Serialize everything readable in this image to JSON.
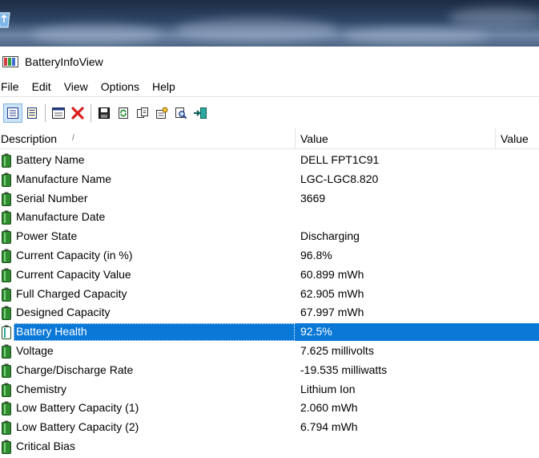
{
  "window": {
    "title": "BatteryInfoView",
    "title_icon": "battery-app-icon"
  },
  "menu": [
    "File",
    "Edit",
    "View",
    "Options",
    "Help"
  ],
  "toolbar": {
    "buttons": [
      {
        "icon": "details-view-icon"
      },
      {
        "icon": "report-view-icon"
      },
      {
        "icon": "properties-window-icon"
      },
      {
        "icon": "delete-red-x-icon"
      },
      {
        "icon": "save-icon"
      },
      {
        "icon": "refresh-icon"
      },
      {
        "icon": "copy-icon"
      },
      {
        "icon": "options-icon"
      },
      {
        "icon": "find-icon"
      },
      {
        "icon": "exit-icon"
      }
    ]
  },
  "table": {
    "columns": [
      "Description",
      "Value",
      "Value"
    ],
    "sort_indicator": "/",
    "rows": [
      {
        "description": "Battery Name",
        "value": "DELL FPT1C91"
      },
      {
        "description": "Manufacture Name",
        "value": "LGC-LGC8.820"
      },
      {
        "description": "Serial Number",
        "value": "3669"
      },
      {
        "description": "Manufacture Date",
        "value": ""
      },
      {
        "description": "Power State",
        "value": "Discharging"
      },
      {
        "description": "Current Capacity (in %)",
        "value": "96.8%"
      },
      {
        "description": "Current Capacity Value",
        "value": "60.899 mWh"
      },
      {
        "description": "Full Charged Capacity",
        "value": "62.905 mWh"
      },
      {
        "description": "Designed Capacity",
        "value": "67.997 mWh"
      },
      {
        "description": "Battery Health",
        "value": "92.5%"
      },
      {
        "description": "Voltage",
        "value": "7.625 millivolts"
      },
      {
        "description": "Charge/Discharge Rate",
        "value": "-19.535 milliwatts"
      },
      {
        "description": "Chemistry",
        "value": "Lithium Ion"
      },
      {
        "description": "Low Battery Capacity (1)",
        "value": "2.060 mWh"
      },
      {
        "description": "Low Battery Capacity (2)",
        "value": "6.794 mWh"
      },
      {
        "description": "Critical Bias",
        "value": ""
      }
    ],
    "selected_index": 9
  },
  "colors": {
    "selection": "#0a78d7",
    "battery_green": "#2e8b2e"
  }
}
